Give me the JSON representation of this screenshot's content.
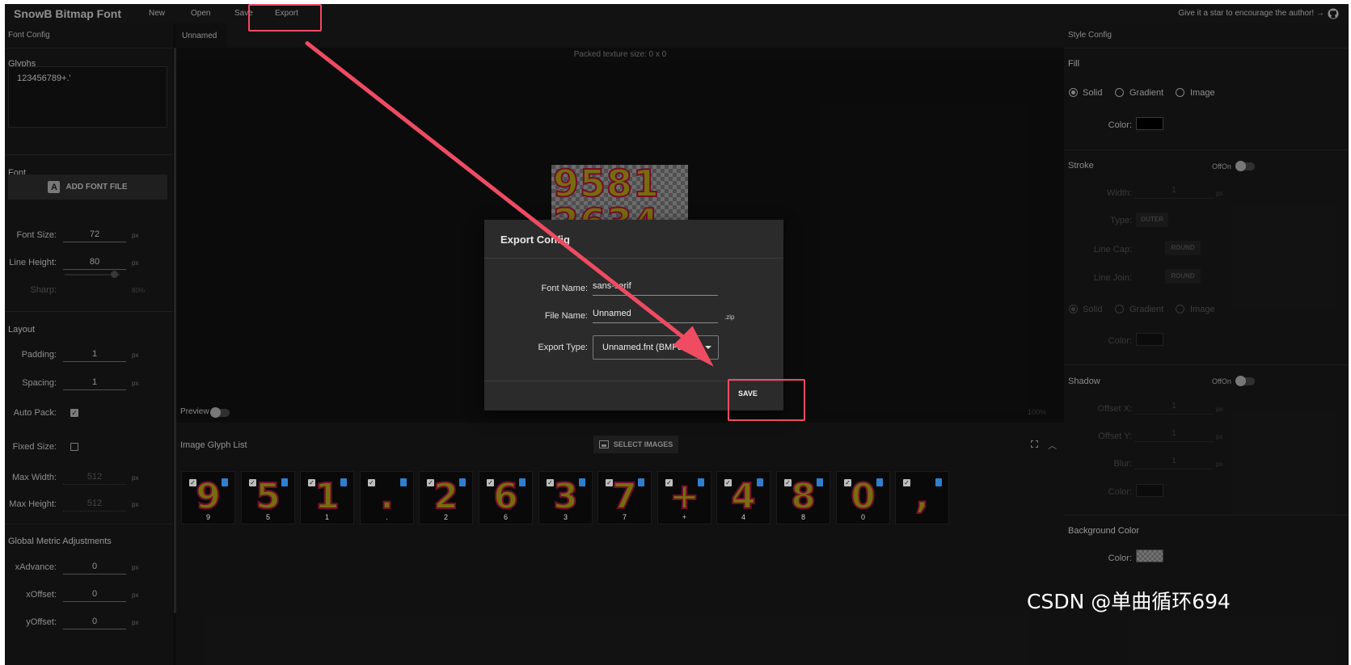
{
  "topbar": {
    "title": "SnowB Bitmap Font",
    "menu": [
      "New",
      "Open",
      "Save",
      "Export"
    ],
    "star_text": "Give it a star to encourage the author!"
  },
  "left": {
    "header": "Font Config",
    "glyphs_title": "Glyphs",
    "glyphs_value": "123456789+.'",
    "font_title": "Font",
    "add_font_label": "ADD FONT FILE",
    "font_size_label": "Font Size:",
    "font_size": "72",
    "line_height_label": "Line Height:",
    "line_height": "80",
    "sharp_label": "Sharp:",
    "sharp_value": "80%",
    "px": "px",
    "layout_title": "Layout",
    "padding_label": "Padding:",
    "padding": "1",
    "spacing_label": "Spacing:",
    "spacing": "1",
    "auto_pack_label": "Auto Pack:",
    "fixed_size_label": "Fixed Size:",
    "max_width_label": "Max Width:",
    "max_width": "512",
    "max_height_label": "Max Height:",
    "max_height": "512",
    "metric_title": "Global Metric Adjustments",
    "xadvance_label": "xAdvance:",
    "xadvance": "0",
    "xoffset_label": "xOffset:",
    "xoffset": "0",
    "yoffset_label": "yOffset:",
    "yoffset": "0"
  },
  "center": {
    "tab": "Unnamed",
    "packed_text": "Packed texture size: 0 x 0",
    "atlas_rows": [
      "9581",
      "2634"
    ],
    "preview_label": "Preview",
    "zoom": "100%",
    "glyph_list_title": "Image Glyph List",
    "select_images_label": "SELECT IMAGES",
    "glyph_tiles": [
      {
        "glyph": "9",
        "label": "9"
      },
      {
        "glyph": "5",
        "label": "5"
      },
      {
        "glyph": "1",
        "label": "1"
      },
      {
        "glyph": ".",
        "label": "."
      },
      {
        "glyph": "2",
        "label": "2"
      },
      {
        "glyph": "6",
        "label": "6"
      },
      {
        "glyph": "3",
        "label": "3"
      },
      {
        "glyph": "7",
        "label": "7"
      },
      {
        "glyph": "+",
        "label": "+"
      },
      {
        "glyph": "4",
        "label": "4"
      },
      {
        "glyph": "8",
        "label": "8"
      },
      {
        "glyph": "0",
        "label": "0"
      },
      {
        "glyph": ",",
        "label": ""
      }
    ]
  },
  "right": {
    "header": "Style Config",
    "fill_title": "Fill",
    "fill_options": [
      "Solid",
      "Gradient",
      "Image"
    ],
    "color_label": "Color:",
    "stroke_title": "Stroke",
    "offon": "OffOn",
    "width_label": "Width:",
    "width": "1",
    "type_label": "Type:",
    "type_selected": "OUTER",
    "line_cap_label": "Line Cap:",
    "line_cap_selected": "ROUND",
    "line_join_label": "Line Join:",
    "line_join_selected": "ROUND",
    "shadow_title": "Shadow",
    "offset_x_label": "Offset X:",
    "offset_x": "1",
    "offset_y_label": "Offset Y:",
    "offset_y": "1",
    "blur_label": "Blur:",
    "blur": "1",
    "bg_title": "Background Color",
    "px": "px"
  },
  "dialog": {
    "title": "Export Config",
    "font_name_label": "Font Name:",
    "font_name": "sans-serif",
    "file_name_label": "File Name:",
    "file_name": "Unnamed",
    "file_ext": ".zip",
    "export_type_label": "Export Type:",
    "export_type": "Unnamed.fnt (BMFont TEXT)",
    "save_label": "SAVE"
  },
  "watermark": "CSDN @单曲循环694",
  "colors": {
    "fill_color": "#000000",
    "highlight": "#ef4b62",
    "glyph_fill": "#b7a616",
    "glyph_stroke": "#b21642"
  }
}
